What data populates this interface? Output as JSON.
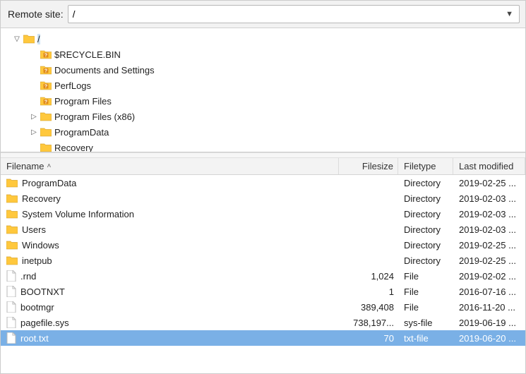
{
  "addr": {
    "label": "Remote site:",
    "value": "/"
  },
  "tree": [
    {
      "depth": 0,
      "expander": "down",
      "kind": "folder",
      "label": "/",
      "selected": true
    },
    {
      "depth": 1,
      "expander": "none",
      "kind": "folder-unknown",
      "label": "$RECYCLE.BIN"
    },
    {
      "depth": 1,
      "expander": "none",
      "kind": "folder-unknown",
      "label": "Documents and Settings"
    },
    {
      "depth": 1,
      "expander": "none",
      "kind": "folder-unknown",
      "label": "PerfLogs"
    },
    {
      "depth": 1,
      "expander": "none",
      "kind": "folder-unknown",
      "label": "Program Files"
    },
    {
      "depth": 1,
      "expander": "right",
      "kind": "folder",
      "label": "Program Files (x86)"
    },
    {
      "depth": 1,
      "expander": "right",
      "kind": "folder",
      "label": "ProgramData"
    },
    {
      "depth": 1,
      "expander": "none",
      "kind": "folder",
      "label": "Recovery"
    }
  ],
  "list": {
    "headers": {
      "name": "Filename",
      "size": "Filesize",
      "type": "Filetype",
      "date": "Last modified"
    },
    "sort_col": "name",
    "sort_dir": "asc",
    "rows": [
      {
        "kind": "dir",
        "name": "ProgramData",
        "size": "",
        "type": "Directory",
        "date": "2019-02-25 ..."
      },
      {
        "kind": "dir",
        "name": "Recovery",
        "size": "",
        "type": "Directory",
        "date": "2019-02-03 ..."
      },
      {
        "kind": "dir",
        "name": "System Volume Information",
        "size": "",
        "type": "Directory",
        "date": "2019-02-03 ..."
      },
      {
        "kind": "dir",
        "name": "Users",
        "size": "",
        "type": "Directory",
        "date": "2019-02-03 ..."
      },
      {
        "kind": "dir",
        "name": "Windows",
        "size": "",
        "type": "Directory",
        "date": "2019-02-25 ..."
      },
      {
        "kind": "dir",
        "name": "inetpub",
        "size": "",
        "type": "Directory",
        "date": "2019-02-25 ..."
      },
      {
        "kind": "file",
        "name": ".rnd",
        "size": "1,024",
        "type": "File",
        "date": "2019-02-02 ..."
      },
      {
        "kind": "file",
        "name": "BOOTNXT",
        "size": "1",
        "type": "File",
        "date": "2016-07-16 ..."
      },
      {
        "kind": "file",
        "name": "bootmgr",
        "size": "389,408",
        "type": "File",
        "date": "2016-11-20 ..."
      },
      {
        "kind": "file",
        "name": "pagefile.sys",
        "size": "738,197...",
        "type": "sys-file",
        "date": "2019-06-19 ..."
      },
      {
        "kind": "file",
        "name": "root.txt",
        "size": "70",
        "type": "txt-file",
        "date": "2019-06-20 ...",
        "selected": true
      }
    ]
  }
}
